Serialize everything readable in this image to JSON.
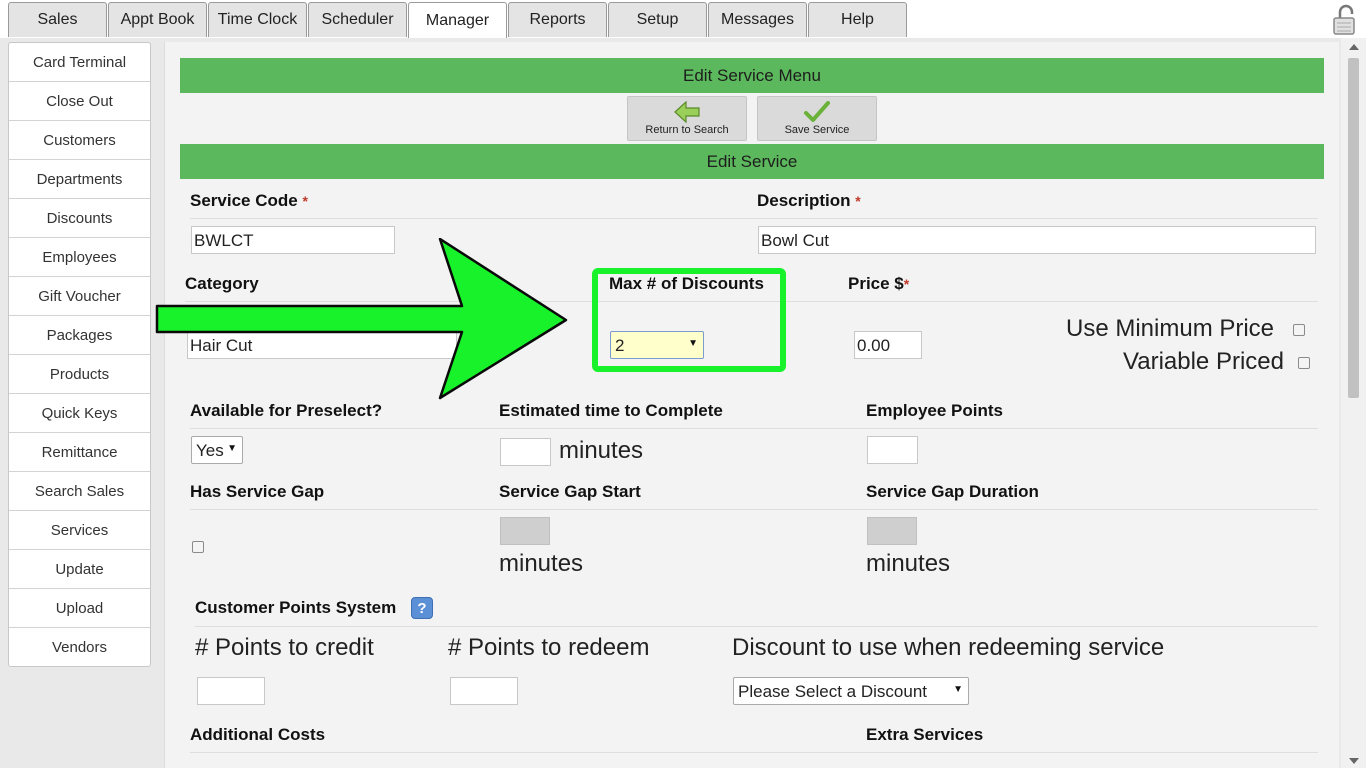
{
  "tabs": [
    {
      "label": "Sales",
      "active": false
    },
    {
      "label": "Appt Book",
      "active": false
    },
    {
      "label": "Time Clock",
      "active": false
    },
    {
      "label": "Scheduler",
      "active": false
    },
    {
      "label": "Manager",
      "active": true
    },
    {
      "label": "Reports",
      "active": false
    },
    {
      "label": "Setup",
      "active": false
    },
    {
      "label": "Messages",
      "active": false
    },
    {
      "label": "Help",
      "active": false
    }
  ],
  "sidebar": {
    "items": [
      {
        "label": "Card Terminal"
      },
      {
        "label": "Close Out"
      },
      {
        "label": "Customers"
      },
      {
        "label": "Departments"
      },
      {
        "label": "Discounts"
      },
      {
        "label": "Employees"
      },
      {
        "label": "Gift Voucher"
      },
      {
        "label": "Packages"
      },
      {
        "label": "Products"
      },
      {
        "label": "Quick Keys"
      },
      {
        "label": "Remittance"
      },
      {
        "label": "Search Sales"
      },
      {
        "label": "Services"
      },
      {
        "label": "Update"
      },
      {
        "label": "Upload"
      },
      {
        "label": "Vendors"
      }
    ]
  },
  "menu": {
    "title": "Edit Service Menu",
    "return_label": "Return to Search",
    "save_label": "Save Service"
  },
  "form": {
    "title": "Edit Service",
    "required_mark": "*",
    "service_code": {
      "label": "Service Code",
      "value": "BWLCT"
    },
    "description": {
      "label": "Description",
      "value": "Bowl Cut"
    },
    "category": {
      "label": "Category",
      "value": "Hair Cut"
    },
    "max_discounts": {
      "label": "Max # of Discounts",
      "value": "2"
    },
    "price": {
      "label": "Price $",
      "value": "0.00"
    },
    "use_min_price": {
      "label": "Use Minimum Price",
      "checked": false
    },
    "variable_priced": {
      "label": "Variable Priced",
      "checked": false
    },
    "preselect": {
      "label": "Available for Preselect?",
      "value": "Yes"
    },
    "est_time": {
      "label": "Estimated time to Complete",
      "value": "",
      "unit": "minutes"
    },
    "employee_points": {
      "label": "Employee Points",
      "value": ""
    },
    "has_gap": {
      "label": "Has Service Gap",
      "checked": false
    },
    "gap_start": {
      "label": "Service Gap Start",
      "unit": "minutes"
    },
    "gap_duration": {
      "label": "Service Gap Duration",
      "unit": "minutes"
    },
    "points_system": {
      "label": "Customer Points System",
      "help": "?"
    },
    "points_credit": {
      "label": "# Points to credit",
      "value": ""
    },
    "points_redeem": {
      "label": "# Points to redeem",
      "value": ""
    },
    "redeem_discount": {
      "label": "Discount to use when redeeming service",
      "value": "Please Select a Discount"
    },
    "additional_costs": {
      "label": "Additional Costs"
    },
    "extra_services": {
      "label": "Extra Services"
    }
  },
  "colors": {
    "accent_green": "#5cb85c",
    "highlight_green": "#18f22a",
    "select_highlight": "#ffffcc"
  }
}
